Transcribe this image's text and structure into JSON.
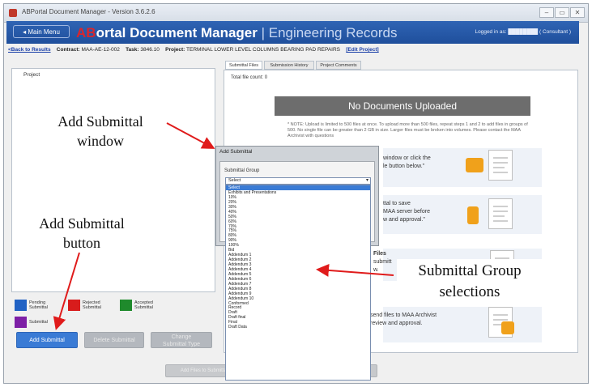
{
  "window": {
    "title": "ABPortal Document Manager - Version 3.6.2.6",
    "controls": [
      "–",
      "▭",
      "✕"
    ]
  },
  "header": {
    "main_menu": "◂ Main Menu",
    "title_red": "AB",
    "title_white": "ortal Document Manager",
    "title_sub": " | Engineering Records",
    "logged_in": "Logged in as: ████████ ( Consultant )",
    "colors": {
      "bar": "#2a5db0",
      "brand": "#d9262c"
    }
  },
  "infobar": {
    "back": "<Back to Results",
    "contract_label": "Contract:",
    "contract_value": "MAA-AE-12-002",
    "task_label": "Task:",
    "task_value": "3846.10",
    "project_label": "Project:",
    "project_value": "TERMINAL LOWER LEVEL COLUMNS BEARING PAD REPAIRS",
    "edit_project": "[Edit Project]"
  },
  "left_panel": {
    "tree_root": "Project",
    "legend": [
      {
        "label": "Pending Submittal",
        "color": "#2162c4"
      },
      {
        "label": "Rejected Submittal",
        "color": "#d81c1c"
      },
      {
        "label": "Accepted Submittal",
        "color": "#1f8a2c"
      },
      {
        "label": "Submittal",
        "color": "#7d1fa6"
      }
    ],
    "buttons": {
      "add": "Add Submittal",
      "delete": "Delete Submittal",
      "change_line1": "Change",
      "change_line2": "Submittal Type"
    }
  },
  "tabs": [
    "Submittal Files",
    "Submission History",
    "Project Comments"
  ],
  "right_panel": {
    "file_count": "Total file count: 0",
    "no_docs": "No Documents Uploaded",
    "note": "* NOTE: Upload is limited to 500 files at once. To upload more than 500 files, repeat steps 1 and 2 to add files in groups of 500. No single file can be greater than 2 GB in size. Larger files must be broken into volumes. Please contact the MAA Archivist with questions",
    "step1": [
      "window or click the",
      "le button below.\""
    ],
    "step2": [
      "ttal to save",
      "MAA server before",
      "w and approval.\""
    ],
    "step3": [
      "Files",
      "submitt",
      "w."
    ],
    "step4": [
      "send files to MAA Archivist",
      "review and approval."
    ]
  },
  "bottom_buttons": [
    "Add Files to Submittal",
    "",
    ""
  ],
  "dialog": {
    "title": "Add Submittal",
    "group_label": "Submittal Group",
    "selected": "Select"
  },
  "submittal_groups": [
    "Select",
    "Exhibits and Presentations",
    "10%",
    "20%",
    "30%",
    "40%",
    "50%",
    "60%",
    "70%",
    "75%",
    "80%",
    "90%",
    "100%",
    "Bid",
    "Addendum 1",
    "Addendum 2",
    "Addendum 3",
    "Addendum 4",
    "Addendum 5",
    "Addendum 6",
    "Addendum 7",
    "Addendum 8",
    "Addendum 9",
    "Addendum 10",
    "Conformed",
    "Record",
    "Draft",
    "Draft final",
    "Final",
    "Draft Data"
  ],
  "annotations": {
    "window": [
      "Add Submittal",
      "window"
    ],
    "button": [
      "Add Submittal",
      "button"
    ],
    "selections": [
      "Submittal Group",
      "selections"
    ]
  }
}
